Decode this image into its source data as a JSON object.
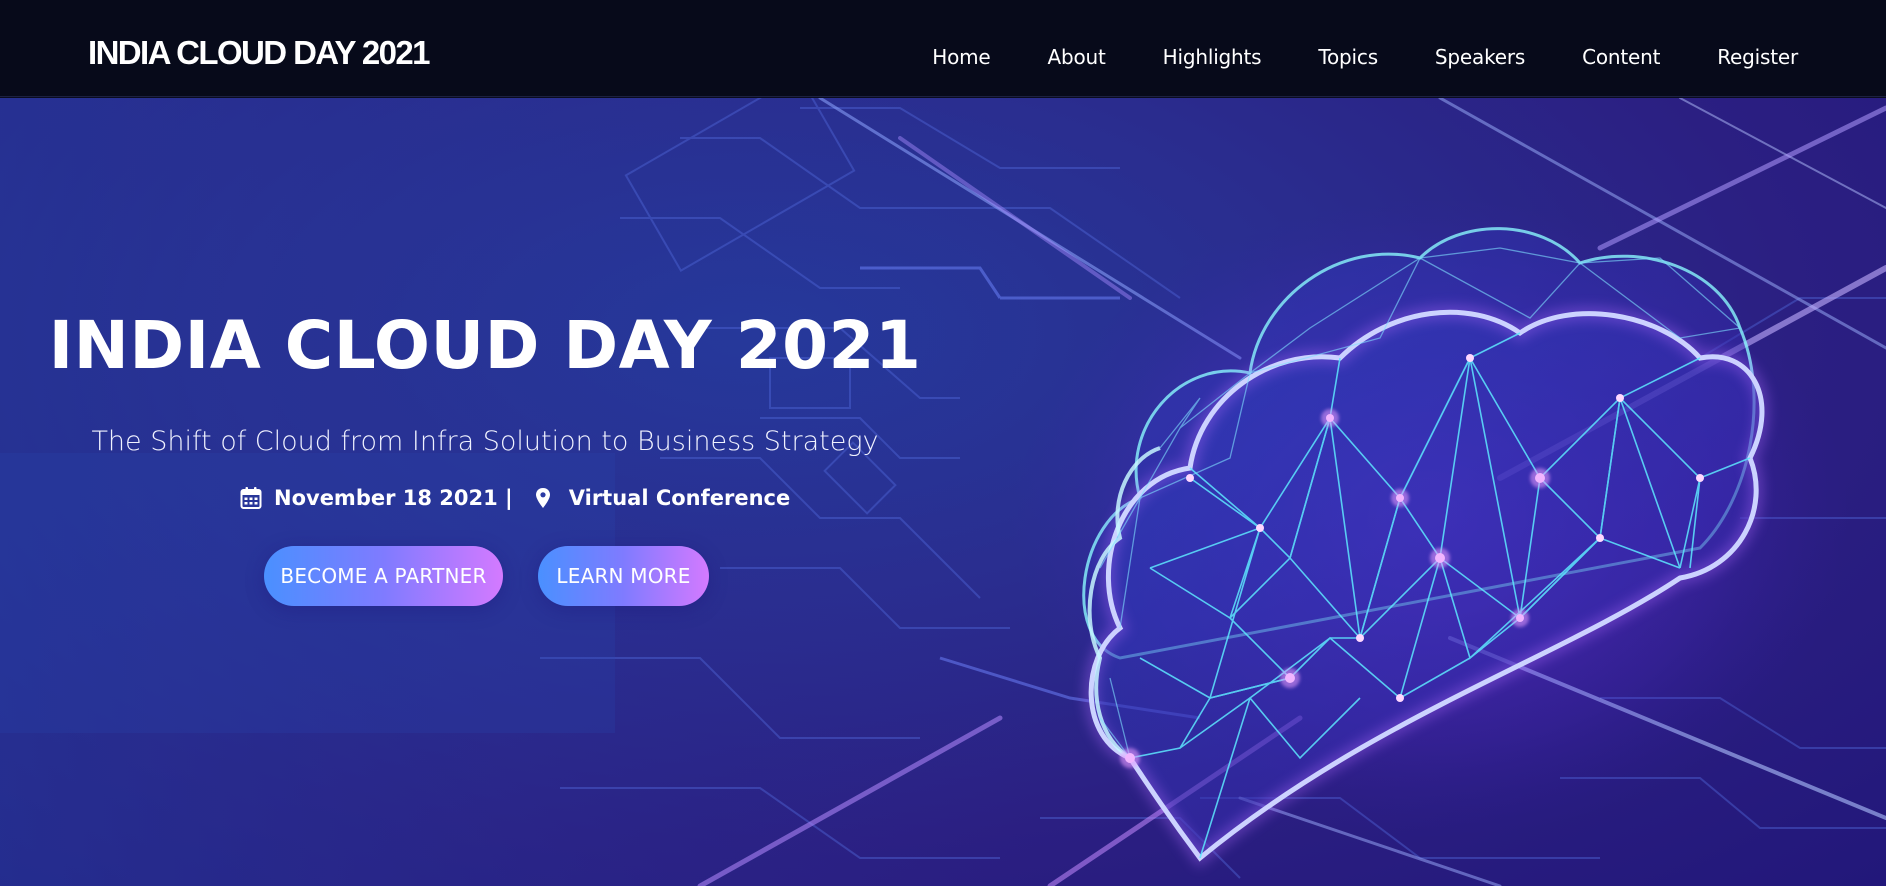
{
  "navbar": {
    "brand": "INDIA CLOUD DAY 2021",
    "links": [
      "Home",
      "About",
      "Highlights",
      "Topics",
      "Speakers",
      "Content",
      "Register"
    ]
  },
  "hero": {
    "title": "INDIA CLOUD DAY 2021",
    "tagline": "The Shift of Cloud from Infra Solution to Business Strategy",
    "date": "November 18 2021 |",
    "location": "Virtual Conference",
    "buttons": {
      "partner": "BECOME A PARTNER",
      "learn_more": "LEARN MORE"
    },
    "icons": {
      "date": "calendar-icon",
      "location": "map-pin-icon"
    }
  },
  "colors": {
    "navbar_bg": "#070a1a",
    "hero_bg": "#2a2d8f",
    "button_gradient_start": "#4a90ff",
    "button_gradient_end": "#d47aff",
    "cloud_glow": "#6ef2ff"
  }
}
